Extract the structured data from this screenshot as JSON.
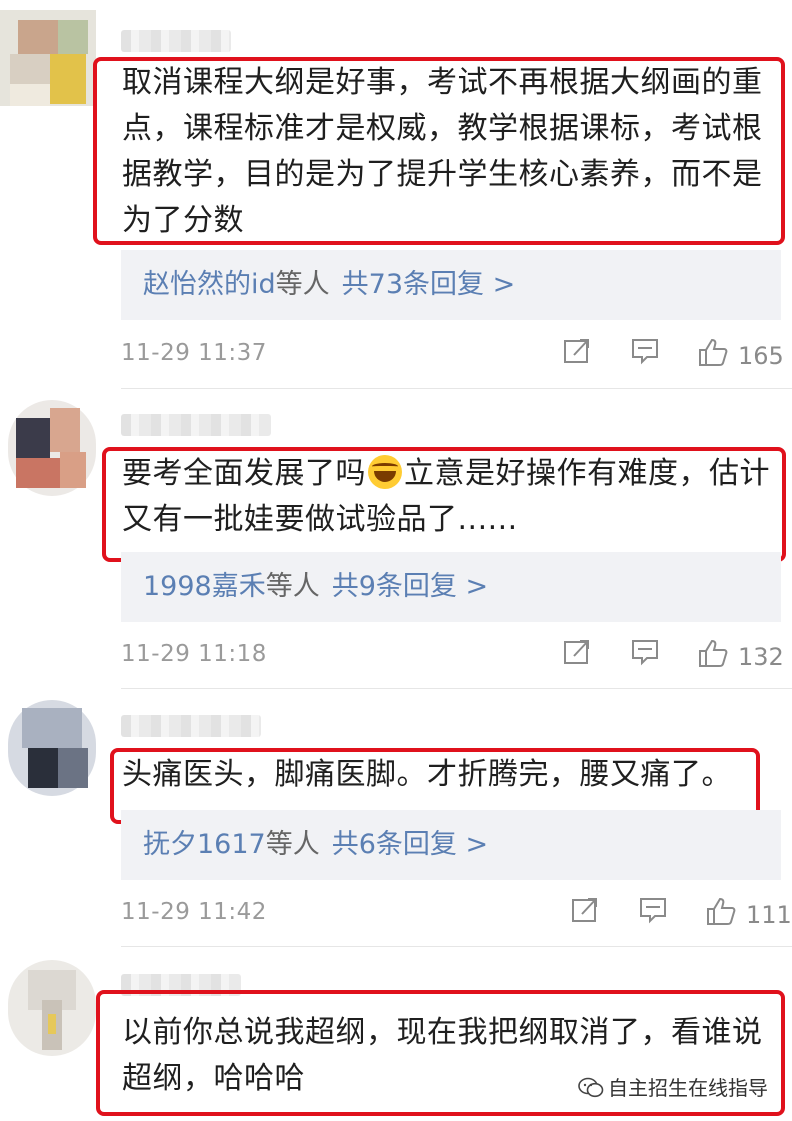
{
  "comments": [
    {
      "text": "取消课程大纲是好事，考试不再根据大纲画的重点，课程标准才是权威，教学根据课标，考试根据教学，目的是为了提升学生核心素养，而不是为了分数",
      "lines": [
        "取消课程大纲是好事，考试不再根据大纲画的重",
        "点，课程标准才是权威，教学根据课标，考试根",
        "据教学，目的是为了提升学生核心素养，而不是",
        "为了分数"
      ],
      "reply_users": "赵怡然的id",
      "reply_mid": "等人",
      "reply_total": "共73条回复 >",
      "time": "11-29 11:37",
      "likes": "165"
    },
    {
      "lines_a": "要考全面发展了吗",
      "emoji": "grinning-tears-emoji",
      "lines_b": "立意是好操作有难度，估计",
      "line2": "又有一批娃要做试验品了......",
      "reply_users": "1998嘉禾",
      "reply_mid": "等人",
      "reply_total": "共9条回复 >",
      "time": "11-29 11:18",
      "likes": "132"
    },
    {
      "line1": "头痛医头，脚痛医脚。才折腾完，腰又痛了。",
      "reply_users": "抚夕1617",
      "reply_mid": "等人",
      "reply_total": "共6条回复 >",
      "time": "11-29 11:42",
      "likes": "111"
    },
    {
      "line1": "以前你总说我超纲，现在我把纲取消了，看谁说",
      "line2": "超纲，哈哈哈"
    }
  ],
  "watermark": "自主招生在线指导",
  "icons": {
    "share": "share-icon",
    "comment": "comment-icon",
    "like": "thumbs-up-icon",
    "watermark": "wechat-icon"
  },
  "colors": {
    "highlight_box": "#e0111c",
    "reply_link": "#5b7fb3",
    "reply_bg": "#f1f2f5",
    "meta_text": "#9a9a9a"
  }
}
